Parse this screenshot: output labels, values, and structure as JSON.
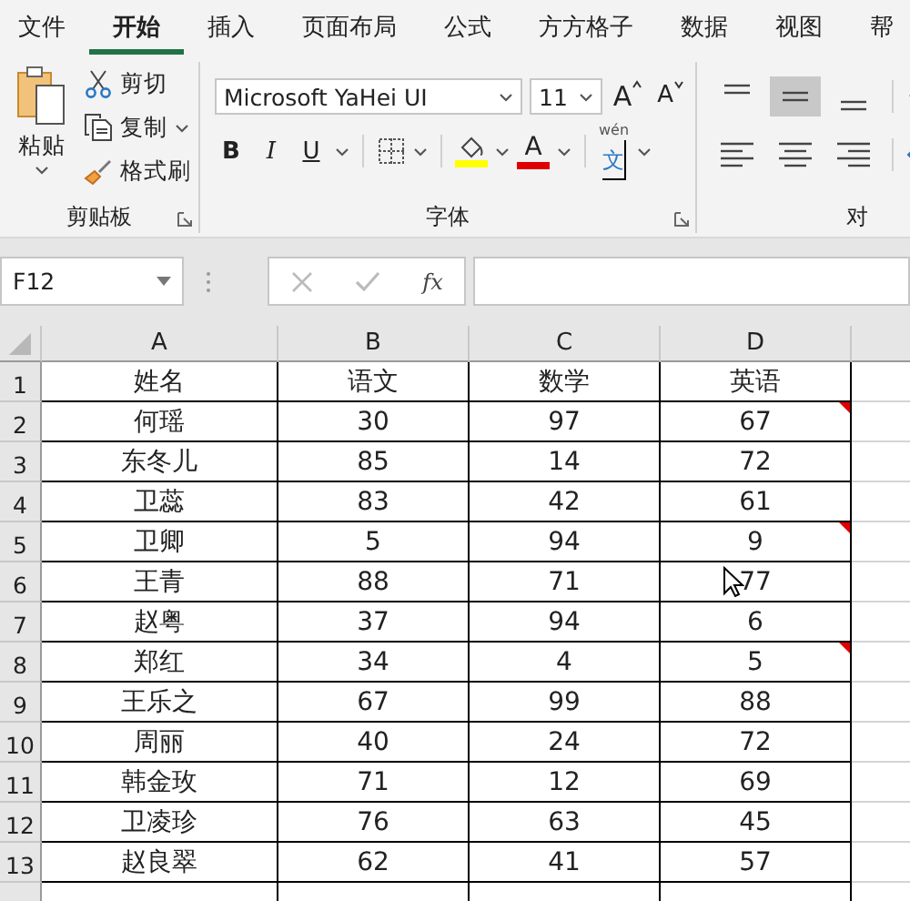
{
  "tabs": [
    {
      "label": "文件",
      "selected": false
    },
    {
      "label": "开始",
      "selected": true
    },
    {
      "label": "插入",
      "selected": false
    },
    {
      "label": "页面布局",
      "selected": false
    },
    {
      "label": "公式",
      "selected": false
    },
    {
      "label": "方方格子",
      "selected": false
    },
    {
      "label": "数据",
      "selected": false
    },
    {
      "label": "视图",
      "selected": false
    },
    {
      "label": "帮",
      "selected": false
    }
  ],
  "ribbon": {
    "clipboard": {
      "paste": "粘贴",
      "cut": "剪切",
      "copy": "复制",
      "format_painter": "格式刷",
      "label": "剪贴板"
    },
    "font": {
      "font_name": "Microsoft YaHei UI",
      "font_size": "11",
      "grow_font": "A",
      "shrink_font": "A",
      "bold": "B",
      "italic": "I",
      "underline": "U",
      "font_color": "A",
      "phonetic_top": "wén",
      "phonetic": "文",
      "label": "字体"
    },
    "alignment": {
      "label": "对"
    }
  },
  "formula_bar": {
    "name_box": "F12",
    "function": "fx"
  },
  "sheet": {
    "columns": [
      "A",
      "B",
      "C",
      "D"
    ],
    "rows": [
      {
        "number": "1",
        "cells": [
          "姓名",
          "语文",
          "数学",
          "英语"
        ],
        "comment": false
      },
      {
        "number": "2",
        "cells": [
          "何瑶",
          "30",
          "97",
          "67"
        ],
        "comment": true
      },
      {
        "number": "3",
        "cells": [
          "东冬儿",
          "85",
          "14",
          "72"
        ],
        "comment": false
      },
      {
        "number": "4",
        "cells": [
          "卫蕊",
          "83",
          "42",
          "61"
        ],
        "comment": false
      },
      {
        "number": "5",
        "cells": [
          "卫卿",
          "5",
          "94",
          "9"
        ],
        "comment": true
      },
      {
        "number": "6",
        "cells": [
          "王青",
          "88",
          "71",
          "77"
        ],
        "comment": false
      },
      {
        "number": "7",
        "cells": [
          "赵粤",
          "37",
          "94",
          "6"
        ],
        "comment": false
      },
      {
        "number": "8",
        "cells": [
          "郑红",
          "34",
          "4",
          "5"
        ],
        "comment": true
      },
      {
        "number": "9",
        "cells": [
          "王乐之",
          "67",
          "99",
          "88"
        ],
        "comment": false
      },
      {
        "number": "10",
        "cells": [
          "周丽",
          "40",
          "24",
          "72"
        ],
        "comment": false
      },
      {
        "number": "11",
        "cells": [
          "韩金玫",
          "71",
          "12",
          "69"
        ],
        "comment": false
      },
      {
        "number": "12",
        "cells": [
          "卫凌珍",
          "76",
          "63",
          "45"
        ],
        "comment": false
      },
      {
        "number": "13",
        "cells": [
          "赵良翠",
          "62",
          "41",
          "57"
        ],
        "comment": false
      }
    ]
  }
}
